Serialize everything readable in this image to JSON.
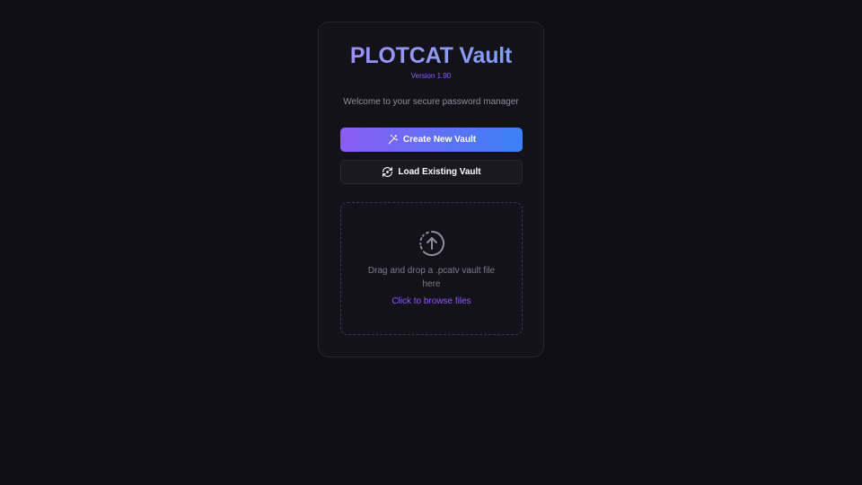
{
  "app": {
    "title": "PLOTCAT Vault",
    "version": "Version 1.90",
    "welcome": "Welcome to your secure password manager"
  },
  "actions": {
    "create_label": "Create New Vault",
    "create_icon": "magic-wand-icon",
    "load_label": "Load Existing Vault",
    "load_icon": "refresh-eye-icon"
  },
  "dropzone": {
    "icon": "upload-arrow-circle-icon",
    "text": "Drag and drop a .pcatv vault file here",
    "browse_label": "Click to browse files"
  },
  "colors": {
    "background": "#100f17",
    "card": "#13121b",
    "accent_purple": "#8b5cf6",
    "accent_blue": "#3b82f6",
    "muted_text": "#8e8d99"
  }
}
